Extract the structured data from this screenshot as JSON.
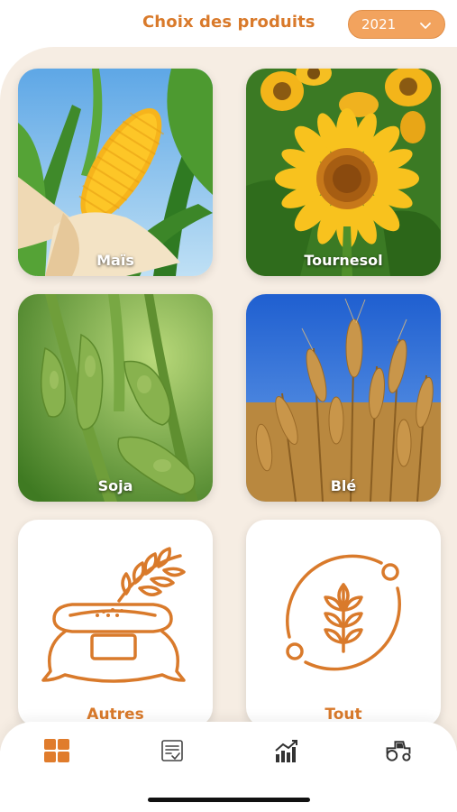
{
  "header": {
    "title": "Choix des produits",
    "year_selected": "2021"
  },
  "products": [
    {
      "label": "Maïs",
      "icon": "corn-image"
    },
    {
      "label": "Tournesol",
      "icon": "sunflower-image"
    },
    {
      "label": "Soja",
      "icon": "soybean-image"
    },
    {
      "label": "Blé",
      "icon": "wheat-image"
    },
    {
      "label": "Autres",
      "icon": "grain-sack-icon"
    },
    {
      "label": "Tout",
      "icon": "wheat-cycle-icon"
    }
  ],
  "nav": {
    "items": [
      {
        "icon": "grid-icon",
        "active": true
      },
      {
        "icon": "checklist-icon",
        "active": false
      },
      {
        "icon": "chart-icon",
        "active": false
      },
      {
        "icon": "tractor-icon",
        "active": false
      }
    ]
  },
  "colors": {
    "accent": "#d97a2b",
    "select_bg": "#f2a35e",
    "panel_bg": "#f6ede3"
  }
}
